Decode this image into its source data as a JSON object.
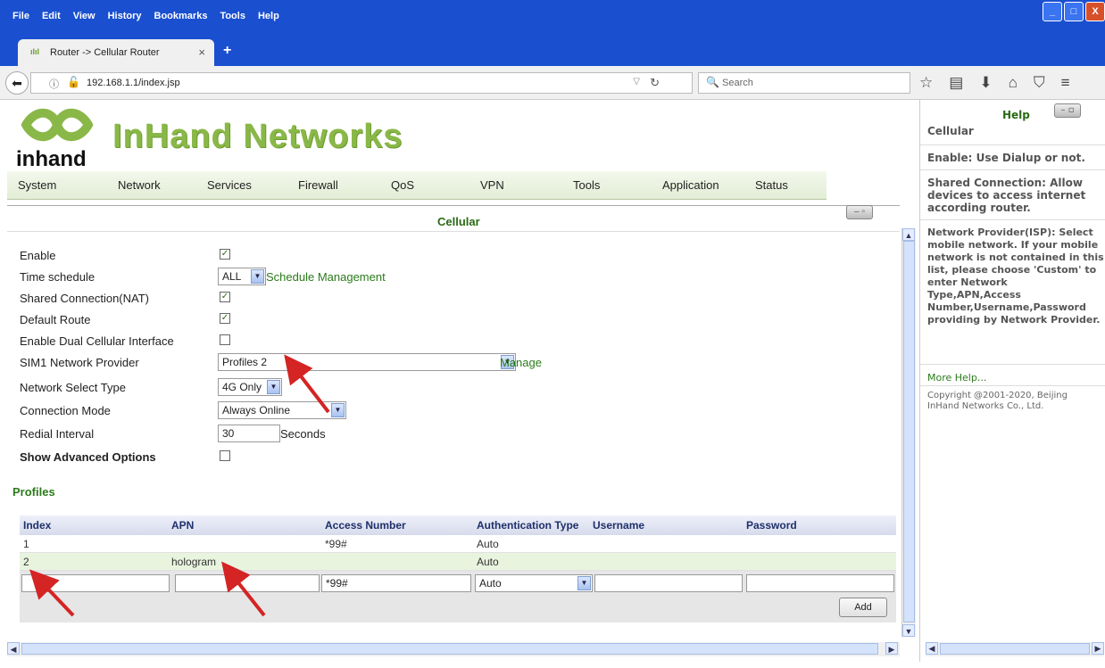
{
  "menubar": {
    "items": [
      "File",
      "Edit",
      "View",
      "History",
      "Bookmarks",
      "Tools",
      "Help"
    ]
  },
  "window_buttons": {
    "minimize": "_",
    "maximize": "□",
    "close": "X"
  },
  "tab": {
    "title": "Router -> Cellular Router",
    "close": "×",
    "new_tab": "+"
  },
  "navbar": {
    "url": "192.168.1.1/index.jsp",
    "search_placeholder": "Search"
  },
  "brand": {
    "logo_text": "inhand",
    "name": "InHand Networks"
  },
  "nav": {
    "items": [
      "System",
      "Network",
      "Services",
      "Firewall",
      "QoS",
      "VPN",
      "Tools",
      "Application",
      "Status"
    ]
  },
  "section": {
    "title": "Cellular"
  },
  "form": {
    "enable": {
      "label": "Enable",
      "checked": true
    },
    "time_schedule": {
      "label": "Time schedule",
      "value": "ALL",
      "link": "Schedule Management"
    },
    "shared_nat": {
      "label": "Shared Connection(NAT)",
      "checked": true
    },
    "default_route": {
      "label": "Default Route",
      "checked": true
    },
    "dual_cellular": {
      "label": "Enable Dual Cellular Interface",
      "checked": false
    },
    "sim1_provider": {
      "label": "SIM1 Network Provider",
      "value": "Profiles 2",
      "link": "Manage"
    },
    "net_select": {
      "label": "Network Select Type",
      "value": "4G Only"
    },
    "conn_mode": {
      "label": "Connection Mode",
      "value": "Always Online"
    },
    "redial": {
      "label": "Redial Interval",
      "value": "30",
      "unit": "Seconds"
    },
    "advanced": {
      "label": "Show Advanced Options",
      "checked": false
    }
  },
  "profiles": {
    "title": "Profiles",
    "headers": [
      "Index",
      "APN",
      "Access Number",
      "Authentication Type",
      "Username",
      "Password"
    ],
    "rows": [
      {
        "index": "1",
        "apn": "",
        "access": "*99#",
        "auth": "Auto"
      },
      {
        "index": "2",
        "apn": "hologram",
        "access": "",
        "auth": "Auto"
      }
    ],
    "new_row": {
      "index": "",
      "apn": "",
      "access": "*99#",
      "auth": "Auto",
      "username": "",
      "password": ""
    },
    "add_button": "Add"
  },
  "help": {
    "title": "Help",
    "topic": "Cellular",
    "p1": "Enable: Use Dialup or not.",
    "p2": "Shared Connection: Allow devices to access internet according router.",
    "p3": "Network Provider(ISP): Select mobile network. If your mobile network is not contained in this list, please choose 'Custom' to enter Network Type,APN,Access Number,Username,Password providing by Network Provider.",
    "more": "More Help...",
    "copyright": "Copyright @2001-2020, Beijing InHand Networks Co., Ltd."
  },
  "colors": {
    "titlebar": "#1a4fd0",
    "brand_green": "#8ab848",
    "link_green": "#2a7a1a",
    "annotation_arrow": "#d42424"
  }
}
